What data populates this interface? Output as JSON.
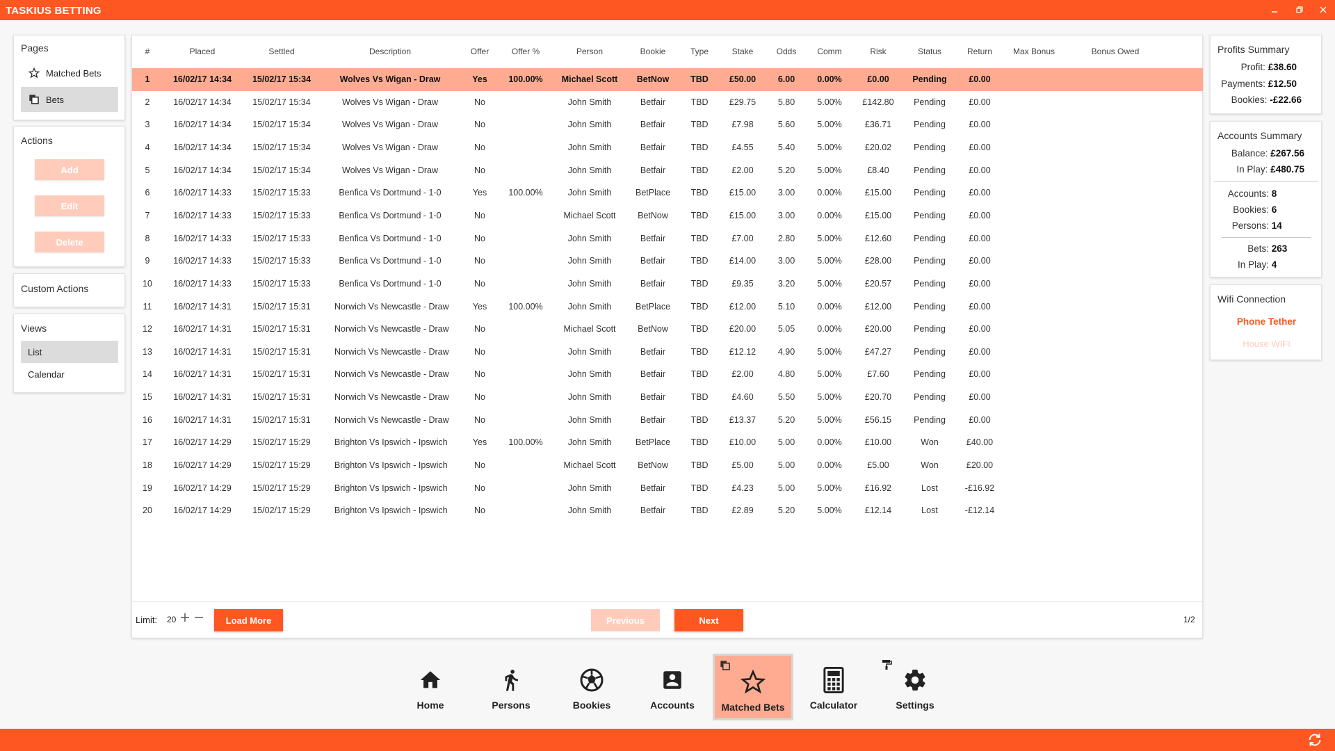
{
  "app": {
    "title": "TASKIUS BETTING",
    "minimize_icon": "minimize-icon",
    "maximize_icon": "restore-icon",
    "close_icon": "close-icon"
  },
  "sidebar": {
    "pages": {
      "title": "Pages",
      "items": [
        {
          "label": "Matched Bets",
          "icon": "star-icon"
        },
        {
          "label": "Bets",
          "icon": "copy-icon",
          "active": true
        }
      ]
    },
    "actions": {
      "title": "Actions",
      "buttons": [
        "Add",
        "Edit",
        "Delete"
      ]
    },
    "custom_actions": {
      "title": "Custom Actions"
    },
    "views": {
      "title": "Views",
      "items": [
        {
          "label": "List",
          "active": true
        },
        {
          "label": "Calendar"
        }
      ]
    }
  },
  "table": {
    "columns": [
      "#",
      "Placed",
      "Settled",
      "Description",
      "Offer",
      "Offer %",
      "Person",
      "Bookie",
      "Type",
      "Stake",
      "Odds",
      "Comm",
      "Risk",
      "Status",
      "Return",
      "Max Bonus",
      "Bonus Owed"
    ],
    "rows": [
      [
        "1",
        "16/02/17 14:34",
        "15/02/17 15:34",
        "Wolves Vs Wigan - Draw",
        "Yes",
        "100.00%",
        "Michael Scott",
        "BetNow",
        "TBD",
        "£50.00",
        "6.00",
        "0.00%",
        "£0.00",
        "Pending",
        "£0.00",
        "",
        ""
      ],
      [
        "2",
        "16/02/17 14:34",
        "15/02/17 15:34",
        "Wolves Vs Wigan - Draw",
        "No",
        "",
        "John Smith",
        "Betfair",
        "TBD",
        "£29.75",
        "5.80",
        "5.00%",
        "£142.80",
        "Pending",
        "£0.00",
        "",
        ""
      ],
      [
        "3",
        "16/02/17 14:34",
        "15/02/17 15:34",
        "Wolves Vs Wigan - Draw",
        "No",
        "",
        "John Smith",
        "Betfair",
        "TBD",
        "£7.98",
        "5.60",
        "5.00%",
        "£36.71",
        "Pending",
        "£0.00",
        "",
        ""
      ],
      [
        "4",
        "16/02/17 14:34",
        "15/02/17 15:34",
        "Wolves Vs Wigan - Draw",
        "No",
        "",
        "John Smith",
        "Betfair",
        "TBD",
        "£4.55",
        "5.40",
        "5.00%",
        "£20.02",
        "Pending",
        "£0.00",
        "",
        ""
      ],
      [
        "5",
        "16/02/17 14:34",
        "15/02/17 15:34",
        "Wolves Vs Wigan - Draw",
        "No",
        "",
        "John Smith",
        "Betfair",
        "TBD",
        "£2.00",
        "5.20",
        "5.00%",
        "£8.40",
        "Pending",
        "£0.00",
        "",
        ""
      ],
      [
        "6",
        "16/02/17 14:33",
        "15/02/17 15:33",
        "Benfica Vs Dortmund - 1-0",
        "Yes",
        "100.00%",
        "John Smith",
        "BetPlace",
        "TBD",
        "£15.00",
        "3.00",
        "0.00%",
        "£15.00",
        "Pending",
        "£0.00",
        "",
        ""
      ],
      [
        "7",
        "16/02/17 14:33",
        "15/02/17 15:33",
        "Benfica Vs Dortmund - 1-0",
        "No",
        "",
        "Michael Scott",
        "BetNow",
        "TBD",
        "£15.00",
        "3.00",
        "0.00%",
        "£15.00",
        "Pending",
        "£0.00",
        "",
        ""
      ],
      [
        "8",
        "16/02/17 14:33",
        "15/02/17 15:33",
        "Benfica Vs Dortmund - 1-0",
        "No",
        "",
        "John Smith",
        "Betfair",
        "TBD",
        "£7.00",
        "2.80",
        "5.00%",
        "£12.60",
        "Pending",
        "£0.00",
        "",
        ""
      ],
      [
        "9",
        "16/02/17 14:33",
        "15/02/17 15:33",
        "Benfica Vs Dortmund - 1-0",
        "No",
        "",
        "John Smith",
        "Betfair",
        "TBD",
        "£14.00",
        "3.00",
        "5.00%",
        "£28.00",
        "Pending",
        "£0.00",
        "",
        ""
      ],
      [
        "10",
        "16/02/17 14:33",
        "15/02/17 15:33",
        "Benfica Vs Dortmund - 1-0",
        "No",
        "",
        "John Smith",
        "Betfair",
        "TBD",
        "£9.35",
        "3.20",
        "5.00%",
        "£20.57",
        "Pending",
        "£0.00",
        "",
        ""
      ],
      [
        "11",
        "16/02/17 14:31",
        "15/02/17 15:31",
        "Norwich Vs Newcastle - Draw",
        "Yes",
        "100.00%",
        "John Smith",
        "BetPlace",
        "TBD",
        "£12.00",
        "5.10",
        "0.00%",
        "£12.00",
        "Pending",
        "£0.00",
        "",
        ""
      ],
      [
        "12",
        "16/02/17 14:31",
        "15/02/17 15:31",
        "Norwich Vs Newcastle - Draw",
        "No",
        "",
        "Michael Scott",
        "BetNow",
        "TBD",
        "£20.00",
        "5.05",
        "0.00%",
        "£20.00",
        "Pending",
        "£0.00",
        "",
        ""
      ],
      [
        "13",
        "16/02/17 14:31",
        "15/02/17 15:31",
        "Norwich Vs Newcastle - Draw",
        "No",
        "",
        "John Smith",
        "Betfair",
        "TBD",
        "£12.12",
        "4.90",
        "5.00%",
        "£47.27",
        "Pending",
        "£0.00",
        "",
        ""
      ],
      [
        "14",
        "16/02/17 14:31",
        "15/02/17 15:31",
        "Norwich Vs Newcastle - Draw",
        "No",
        "",
        "John Smith",
        "Betfair",
        "TBD",
        "£2.00",
        "4.80",
        "5.00%",
        "£7.60",
        "Pending",
        "£0.00",
        "",
        ""
      ],
      [
        "15",
        "16/02/17 14:31",
        "15/02/17 15:31",
        "Norwich Vs Newcastle - Draw",
        "No",
        "",
        "John Smith",
        "Betfair",
        "TBD",
        "£4.60",
        "5.50",
        "5.00%",
        "£20.70",
        "Pending",
        "£0.00",
        "",
        ""
      ],
      [
        "16",
        "16/02/17 14:31",
        "15/02/17 15:31",
        "Norwich Vs Newcastle - Draw",
        "No",
        "",
        "John Smith",
        "Betfair",
        "TBD",
        "£13.37",
        "5.20",
        "5.00%",
        "£56.15",
        "Pending",
        "£0.00",
        "",
        ""
      ],
      [
        "17",
        "16/02/17 14:29",
        "15/02/17 15:29",
        "Brighton Vs Ipswich - Ipswich",
        "Yes",
        "100.00%",
        "John Smith",
        "BetPlace",
        "TBD",
        "£10.00",
        "5.00",
        "0.00%",
        "£10.00",
        "Won",
        "£40.00",
        "",
        ""
      ],
      [
        "18",
        "16/02/17 14:29",
        "15/02/17 15:29",
        "Brighton Vs Ipswich - Ipswich",
        "No",
        "",
        "Michael Scott",
        "BetNow",
        "TBD",
        "£5.00",
        "5.00",
        "0.00%",
        "£5.00",
        "Won",
        "£20.00",
        "",
        ""
      ],
      [
        "19",
        "16/02/17 14:29",
        "15/02/17 15:29",
        "Brighton Vs Ipswich - Ipswich",
        "No",
        "",
        "John Smith",
        "Betfair",
        "TBD",
        "£4.23",
        "5.00",
        "5.00%",
        "£16.92",
        "Lost",
        "-£16.92",
        "",
        ""
      ],
      [
        "20",
        "16/02/17 14:29",
        "15/02/17 15:29",
        "Brighton Vs Ipswich - Ipswich",
        "No",
        "",
        "John Smith",
        "Betfair",
        "TBD",
        "£2.89",
        "5.20",
        "5.00%",
        "£12.14",
        "Lost",
        "-£12.14",
        "",
        ""
      ]
    ],
    "selected_row": 1
  },
  "footer": {
    "limit_label": "Limit:",
    "limit_value": "20",
    "load_more": "Load More",
    "previous": "Previous",
    "next": "Next",
    "page_indicator": "1/2"
  },
  "profits_summary": {
    "title": "Profits Summary",
    "lines": [
      {
        "label": "Profit:",
        "value": "£38.60"
      },
      {
        "label": "Payments:",
        "value": "£12.50"
      },
      {
        "label": "Bookies:",
        "value": "-£22.66"
      }
    ]
  },
  "accounts_summary": {
    "title": "Accounts Summary",
    "group1": [
      {
        "label": "Balance:",
        "value": "£267.56"
      },
      {
        "label": "In Play:",
        "value": "£480.75"
      }
    ],
    "group2": [
      {
        "label": "Accounts:",
        "value": "8"
      },
      {
        "label": "Bookies:",
        "value": "6"
      },
      {
        "label": "Persons:",
        "value": "14"
      }
    ],
    "group3": [
      {
        "label": "Bets:",
        "value": "263"
      },
      {
        "label": "In Play:",
        "value": "4"
      }
    ]
  },
  "wifi": {
    "title": "Wifi Connection",
    "active": "Phone Tether",
    "inactive": "House WIFI"
  },
  "dock": [
    {
      "label": "Home",
      "icon": "home-icon"
    },
    {
      "label": "Persons",
      "icon": "walking-person-icon"
    },
    {
      "label": "Bookies",
      "icon": "soccer-ball-icon"
    },
    {
      "label": "Accounts",
      "icon": "account-box-icon"
    },
    {
      "label": "Matched Bets",
      "icon": "star-icon",
      "active": true
    },
    {
      "label": "Calculator",
      "icon": "calculator-icon"
    },
    {
      "label": "Settings",
      "icon": "gear-icon"
    }
  ],
  "colors": {
    "accent": "#ff5722",
    "selected_row": "#ffab91",
    "disabled": "#ffccbc"
  },
  "statusbar": {
    "icon": "refresh-icon"
  }
}
